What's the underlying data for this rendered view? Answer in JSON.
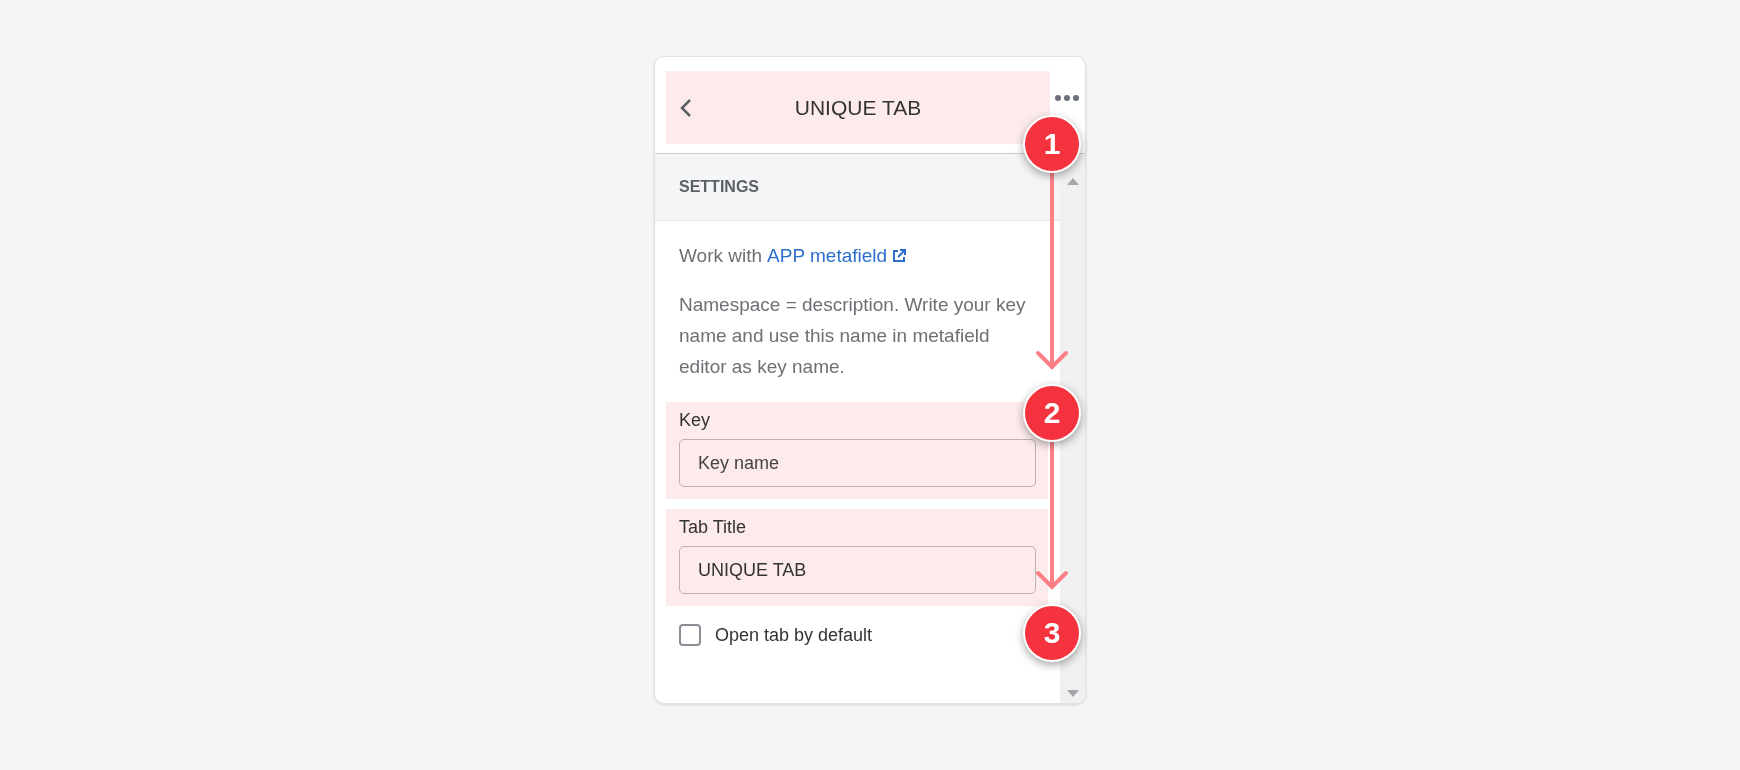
{
  "header": {
    "title": "UNIQUE TAB",
    "highlighted": true
  },
  "section": {
    "title": "SETTINGS"
  },
  "intro": {
    "text": "Work with",
    "link": "APP metafield"
  },
  "description": "Namespace = description. Write your key name and use this name in metafield editor as key name.",
  "fields": [
    {
      "label": "Key",
      "placeholder": "Key name",
      "highlighted": true
    },
    {
      "label": "Tab Title",
      "value": "UNIQUE TAB",
      "highlighted": true
    }
  ],
  "checkbox": {
    "label": "Open tab by default",
    "checked": false
  },
  "steps": [
    "1",
    "2",
    "3"
  ]
}
